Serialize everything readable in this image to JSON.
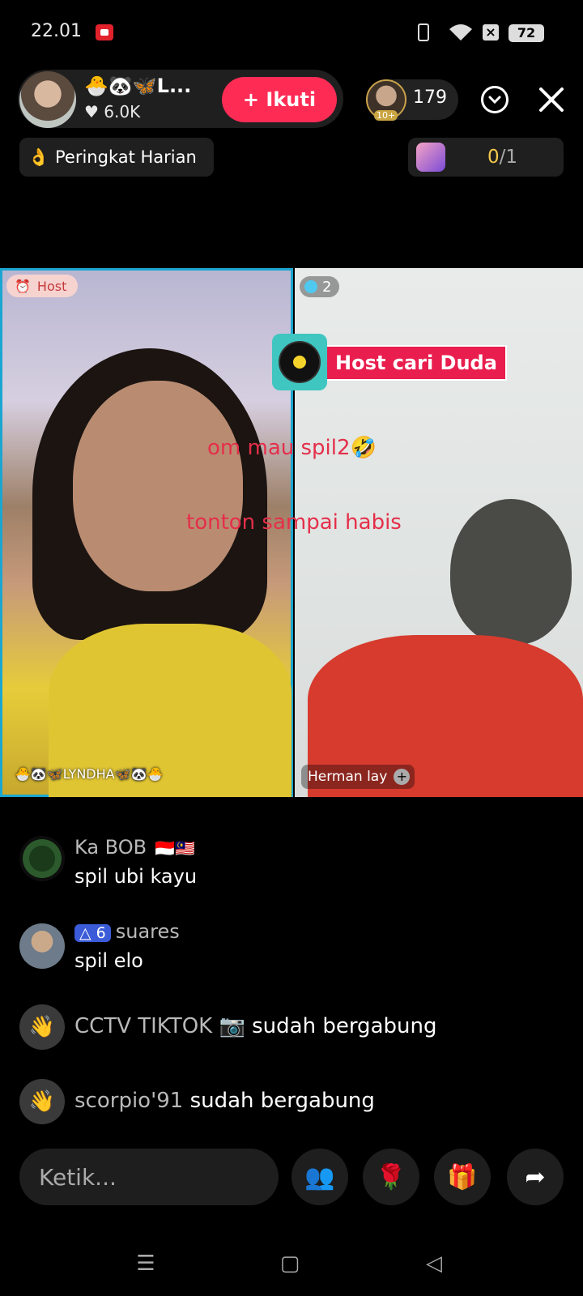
{
  "status_bar": {
    "time": "22.01",
    "battery": "72",
    "sim": "×"
  },
  "host": {
    "name": "🐣🐼🦋L...",
    "likes": "♥ 6.0K",
    "follow_label": "+ Ikuti"
  },
  "viewers": {
    "count": "179",
    "badge": "10+"
  },
  "ranking": {
    "icon": "👌",
    "label": "Peringkat Harian"
  },
  "goal": {
    "done": "0",
    "total": "/1"
  },
  "battle": {
    "host_tag": "Host",
    "left_name": "🐣🐼🦋LYNDHA🦋🐼🐣",
    "right_viewers": "2",
    "song": "Host cari Duda",
    "overlay_1": "om mau spil2🤣",
    "overlay_2": "tonton sampai habis",
    "right_name": "Herman lay",
    "right_name_plus": "+"
  },
  "chat": [
    {
      "user": "Ka BOB",
      "flags": "🇮🇩🇲🇾",
      "message": "spil ubi kayu"
    },
    {
      "level": "△ 6",
      "user": "suares",
      "message": "spil elo"
    }
  ],
  "joins": [
    {
      "user": "CCTV TIKTOK 📷",
      "text": "sudah bergabung"
    },
    {
      "user": "scorpio'91",
      "text": "sudah bergabung"
    }
  ],
  "bottom_bar": {
    "placeholder": "Ketik..."
  },
  "icons": {
    "wave": "👋",
    "multi_guest": "👥",
    "rose": "🌹",
    "gift": "🎁",
    "share": "➦",
    "nav_menu": "☰",
    "nav_home": "▢",
    "nav_back": "◁"
  },
  "colors": {
    "accent": "#fe2c55",
    "host_frame": "#1aa6d1",
    "overlay_text": "#e52f4a"
  }
}
